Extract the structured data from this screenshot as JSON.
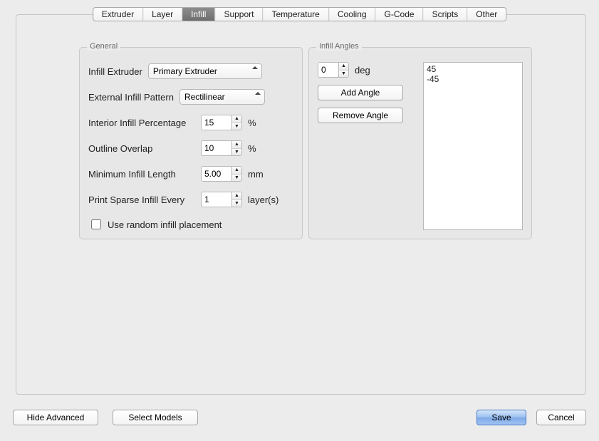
{
  "tabs": [
    "Extruder",
    "Layer",
    "Infill",
    "Support",
    "Temperature",
    "Cooling",
    "G-Code",
    "Scripts",
    "Other"
  ],
  "selected_tab": "Infill",
  "general": {
    "legend": "General",
    "infill_extruder_label": "Infill Extruder",
    "infill_extruder_value": "Primary Extruder",
    "external_pattern_label": "External Infill Pattern",
    "external_pattern_value": "Rectilinear",
    "interior_percent_label": "Interior Infill Percentage",
    "interior_percent_value": "15",
    "interior_percent_unit": "%",
    "outline_overlap_label": "Outline Overlap",
    "outline_overlap_value": "10",
    "outline_overlap_unit": "%",
    "min_length_label": "Minimum Infill Length",
    "min_length_value": "5.00",
    "min_length_unit": "mm",
    "sparse_every_label": "Print Sparse Infill Every",
    "sparse_every_value": "1",
    "sparse_every_unit": "layer(s)",
    "random_placement_label": "Use random infill placement",
    "random_placement_checked": false
  },
  "angles": {
    "legend": "Infill Angles",
    "input_value": "0",
    "input_unit": "deg",
    "add_label": "Add Angle",
    "remove_label": "Remove Angle",
    "list": [
      "45",
      "-45"
    ]
  },
  "footer": {
    "hide_advanced": "Hide Advanced",
    "select_models": "Select Models",
    "save": "Save",
    "cancel": "Cancel"
  }
}
